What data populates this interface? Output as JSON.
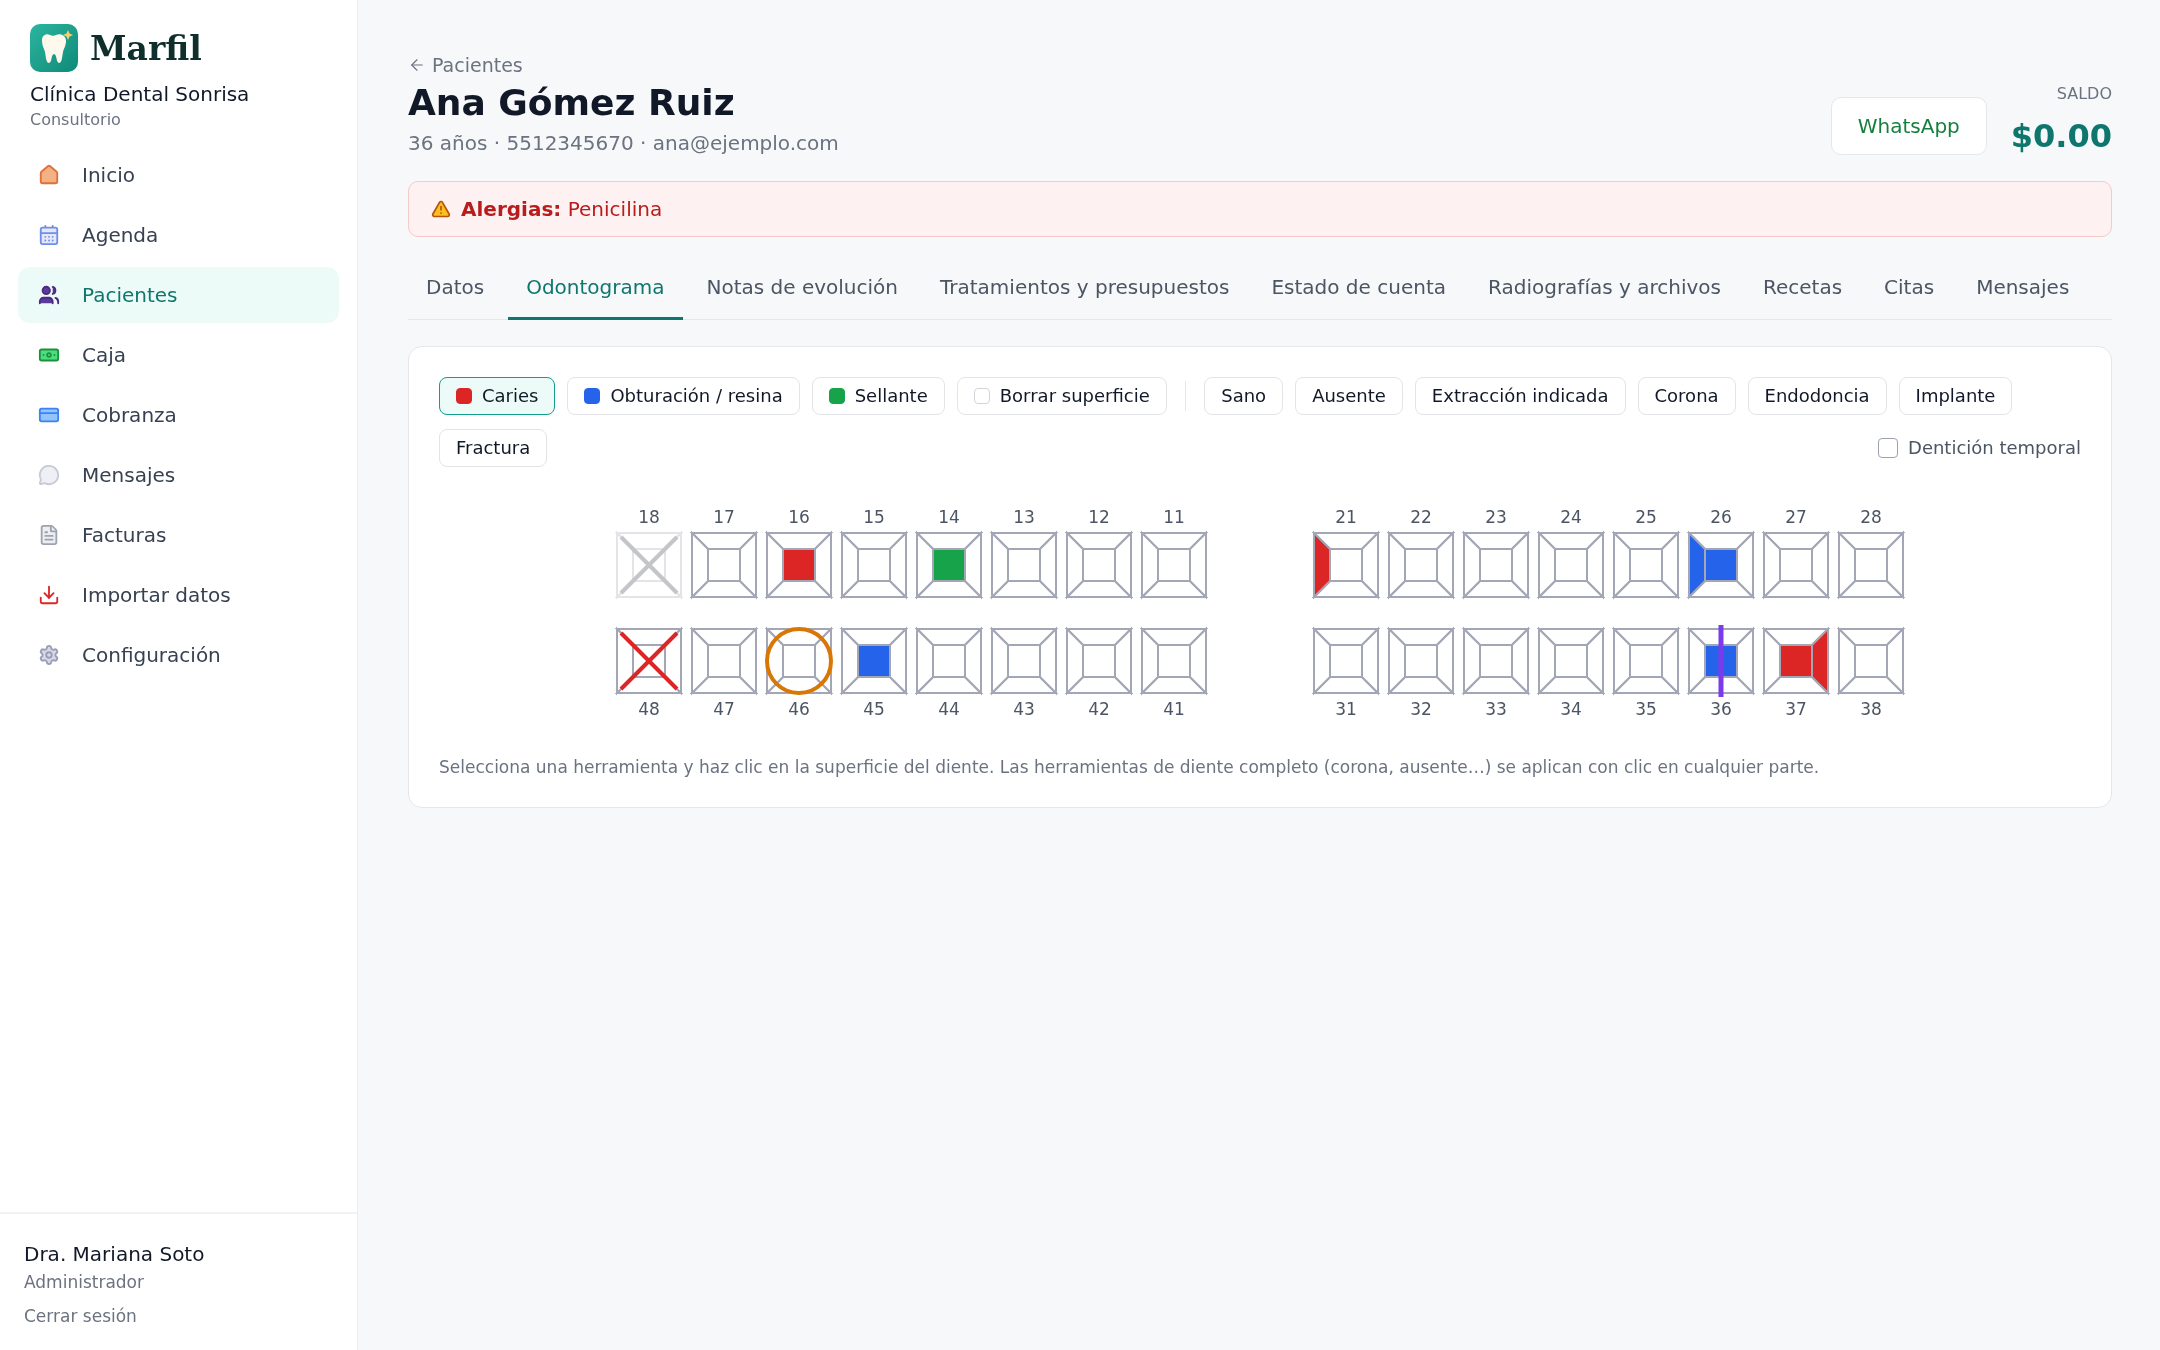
{
  "sidebar": {
    "brand": "Marfil",
    "clinic": "Clínica Dental Sonrisa",
    "clinic_type": "Consultorio",
    "items": [
      {
        "label": "Inicio",
        "selected": false
      },
      {
        "label": "Agenda",
        "selected": false
      },
      {
        "label": "Pacientes",
        "selected": true
      },
      {
        "label": "Caja",
        "selected": false
      },
      {
        "label": "Cobranza",
        "selected": false
      },
      {
        "label": "Mensajes",
        "selected": false
      },
      {
        "label": "Facturas",
        "selected": false
      },
      {
        "label": "Importar datos",
        "selected": false
      },
      {
        "label": "Configuración",
        "selected": false
      }
    ],
    "user": {
      "name": "Dra. Mariana Soto",
      "role": "Administrador",
      "logout": "Cerrar sesión"
    }
  },
  "patient": {
    "back": "Pacientes",
    "name": "Ana Gómez Ruiz",
    "details": "36 años · 5512345670 · ana@ejemplo.com",
    "whatsapp": "WhatsApp",
    "balance_label": "SALDO",
    "balance": "$0.00"
  },
  "alert": {
    "text": "**Alergias:** Penicilina"
  },
  "tabs": [
    {
      "label": "Datos",
      "selected": false
    },
    {
      "label": "Odontograma",
      "selected": true
    },
    {
      "label": "Notas de evolución",
      "selected": false
    },
    {
      "label": "Tratamientos y presupuestos",
      "selected": false
    },
    {
      "label": "Estado de cuenta",
      "selected": false
    },
    {
      "label": "Radiografías y archivos",
      "selected": false
    },
    {
      "label": "Recetas",
      "selected": false
    },
    {
      "label": "Citas",
      "selected": false
    },
    {
      "label": "Mensajes",
      "selected": false
    }
  ],
  "tools": [
    {
      "label": "Caries",
      "kind": "surface",
      "color": "#dc2626",
      "selected": true
    },
    {
      "label": "Obturación / resina",
      "kind": "surface",
      "color": "#2563eb",
      "selected": false
    },
    {
      "label": "Sellante",
      "kind": "surface",
      "color": "#16a34a",
      "selected": false
    },
    {
      "label": "Borrar superficie",
      "kind": "erase",
      "selected": false
    },
    {
      "label": "Sano",
      "kind": "whole",
      "selected": false
    },
    {
      "label": "Ausente",
      "kind": "whole",
      "selected": false
    },
    {
      "label": "Extracción indicada",
      "kind": "whole",
      "selected": false
    },
    {
      "label": "Corona",
      "kind": "whole",
      "selected": false
    },
    {
      "label": "Endodoncia",
      "kind": "whole",
      "selected": false
    },
    {
      "label": "Implante",
      "kind": "whole",
      "selected": false
    },
    {
      "label": "Fractura",
      "kind": "whole",
      "selected": false
    }
  ],
  "temporary_dentition": {
    "label": "Dentición temporal",
    "checked": false
  },
  "odontogram": {
    "upper": [
      {
        "number": "18",
        "kind": "absent"
      },
      {
        "number": "17",
        "kind": "sound"
      },
      {
        "number": "16",
        "kind": "sound",
        "surfaces": [
          {
            "kind": "center",
            "color": "#dc2626"
          }
        ]
      },
      {
        "number": "15",
        "kind": "sound"
      },
      {
        "number": "14",
        "kind": "sound",
        "surfaces": [
          {
            "kind": "center",
            "color": "#16a34a"
          }
        ]
      },
      {
        "number": "13",
        "kind": "sound"
      },
      {
        "number": "12",
        "kind": "sound"
      },
      {
        "number": "11",
        "kind": "sound"
      },
      {
        "number": "21",
        "kind": "sound",
        "surfaces": [
          {
            "kind": "left",
            "color": "#dc2626"
          }
        ]
      },
      {
        "number": "22",
        "kind": "sound"
      },
      {
        "number": "23",
        "kind": "sound"
      },
      {
        "number": "24",
        "kind": "sound"
      },
      {
        "number": "25",
        "kind": "sound"
      },
      {
        "number": "26",
        "kind": "sound",
        "surfaces": [
          {
            "kind": "left",
            "color": "#2563eb"
          },
          {
            "kind": "center",
            "color": "#2563eb"
          }
        ]
      },
      {
        "number": "27",
        "kind": "sound"
      },
      {
        "number": "28",
        "kind": "sound"
      }
    ],
    "lower": [
      {
        "number": "48",
        "kind": "extraction"
      },
      {
        "number": "47",
        "kind": "sound"
      },
      {
        "number": "46",
        "kind": "crown"
      },
      {
        "number": "45",
        "kind": "sound",
        "surfaces": [
          {
            "kind": "center",
            "color": "#2563eb"
          }
        ]
      },
      {
        "number": "44",
        "kind": "sound"
      },
      {
        "number": "43",
        "kind": "sound"
      },
      {
        "number": "42",
        "kind": "sound"
      },
      {
        "number": "41",
        "kind": "sound"
      },
      {
        "number": "31",
        "kind": "sound"
      },
      {
        "number": "32",
        "kind": "sound"
      },
      {
        "number": "33",
        "kind": "sound"
      },
      {
        "number": "34",
        "kind": "sound"
      },
      {
        "number": "35",
        "kind": "sound"
      },
      {
        "number": "36",
        "kind": "endodontics",
        "surfaces": [
          {
            "kind": "center",
            "color": "#2563eb"
          }
        ]
      },
      {
        "number": "37",
        "kind": "sound",
        "surfaces": [
          {
            "kind": "center",
            "color": "#dc2626"
          },
          {
            "kind": "right",
            "color": "#dc2626"
          }
        ]
      },
      {
        "number": "38",
        "kind": "sound"
      }
    ]
  },
  "hint": "Selecciona una herramienta y haz clic en la superficie del diente. Las herramientas de diente completo (corona, ausente…) se aplican con clic en cualquier parte."
}
